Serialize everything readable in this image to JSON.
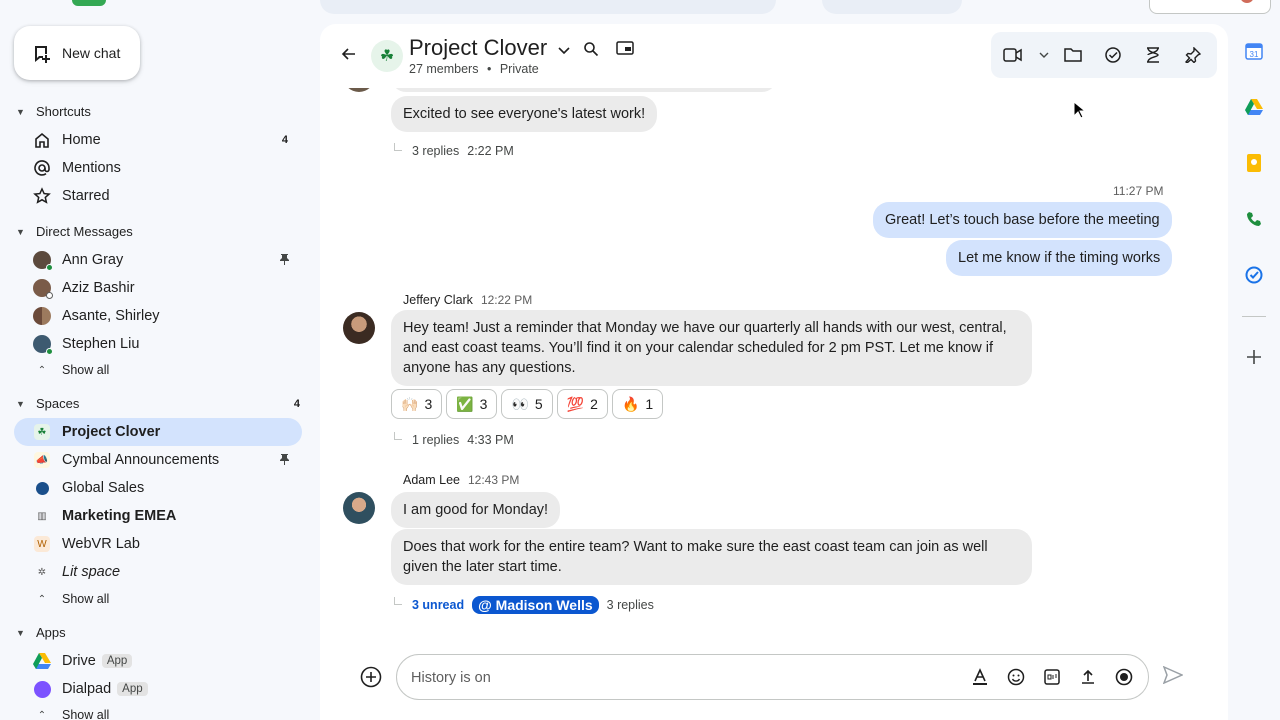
{
  "sidebar": {
    "new_chat_label": "New chat",
    "sections": {
      "shortcuts": "Shortcuts",
      "direct_messages": "Direct Messages",
      "spaces": "Spaces",
      "spaces_count": "4",
      "apps": "Apps"
    },
    "shortcuts": [
      {
        "label": "Home",
        "count": "4",
        "icon": "home-icon"
      },
      {
        "label": "Mentions",
        "icon": "at-icon"
      },
      {
        "label": "Starred",
        "icon": "star-icon"
      }
    ],
    "dms": [
      {
        "label": "Ann Gray",
        "pinned": true
      },
      {
        "label": "Aziz Bashir"
      },
      {
        "label": "Asante, Shirley"
      },
      {
        "label": "Stephen Liu"
      }
    ],
    "dm_show_all": "Show all",
    "spaces": [
      {
        "label": "Project Clover",
        "active": true
      },
      {
        "label": "Cymbal Announcements",
        "pinned": true
      },
      {
        "label": "Global Sales"
      },
      {
        "label": "Marketing EMEA",
        "bold": true
      },
      {
        "label": "WebVR Lab",
        "icon_letter": "W"
      },
      {
        "label": "Lit space",
        "italic": true
      }
    ],
    "spaces_show_all": "Show all",
    "apps": [
      {
        "label": "Drive",
        "badge": "App"
      },
      {
        "label": "Dialpad",
        "badge": "App"
      }
    ],
    "apps_show_all": "Show all"
  },
  "header": {
    "title": "Project Clover",
    "members": "27 members",
    "separator": "•",
    "privacy": "Private",
    "space_emoji": "☘"
  },
  "messages": {
    "m1_text": "Excited to see everyone's latest work!",
    "m1_replies": "3 replies",
    "m1_time": "2:22 PM",
    "mine_time": "11:27 PM",
    "mine_1": "Great! Let’s touch base before the meeting",
    "mine_2": "Let me know if the timing works",
    "jeff_name": "Jeffery Clark",
    "jeff_time": "12:22 PM",
    "jeff_text": "Hey team! Just a reminder that Monday we have our quarterly all hands with our west, central, and east coast teams. You’ll find it on your calendar scheduled for 2 pm PST. Let me know if anyone has any questions.",
    "reactions": [
      {
        "emoji": "🙌🏻",
        "count": "3"
      },
      {
        "emoji": "✅",
        "count": "3"
      },
      {
        "emoji": "👀",
        "count": "5"
      },
      {
        "emoji": "💯",
        "count": "2"
      },
      {
        "emoji": "🔥",
        "count": "1"
      }
    ],
    "jeff_replies": "1 replies",
    "jeff_reply_time": "4:33 PM",
    "adam_name": "Adam Lee",
    "adam_time": "12:43 PM",
    "adam_1": "I am good for Monday!",
    "adam_2": "Does that work for the entire team? Want to make sure the east coast team can join as well given the later start time.",
    "adam_unread": "3 unread",
    "adam_mention": "@ Madison Wells",
    "adam_replies": "3 replies"
  },
  "composer": {
    "placeholder": "History is on"
  },
  "colors": {
    "accent": "#0b57d0",
    "active_nav": "#d3e3fd",
    "my_bubble": "#d3e3fd",
    "other_bubble": "#ebebeb"
  }
}
